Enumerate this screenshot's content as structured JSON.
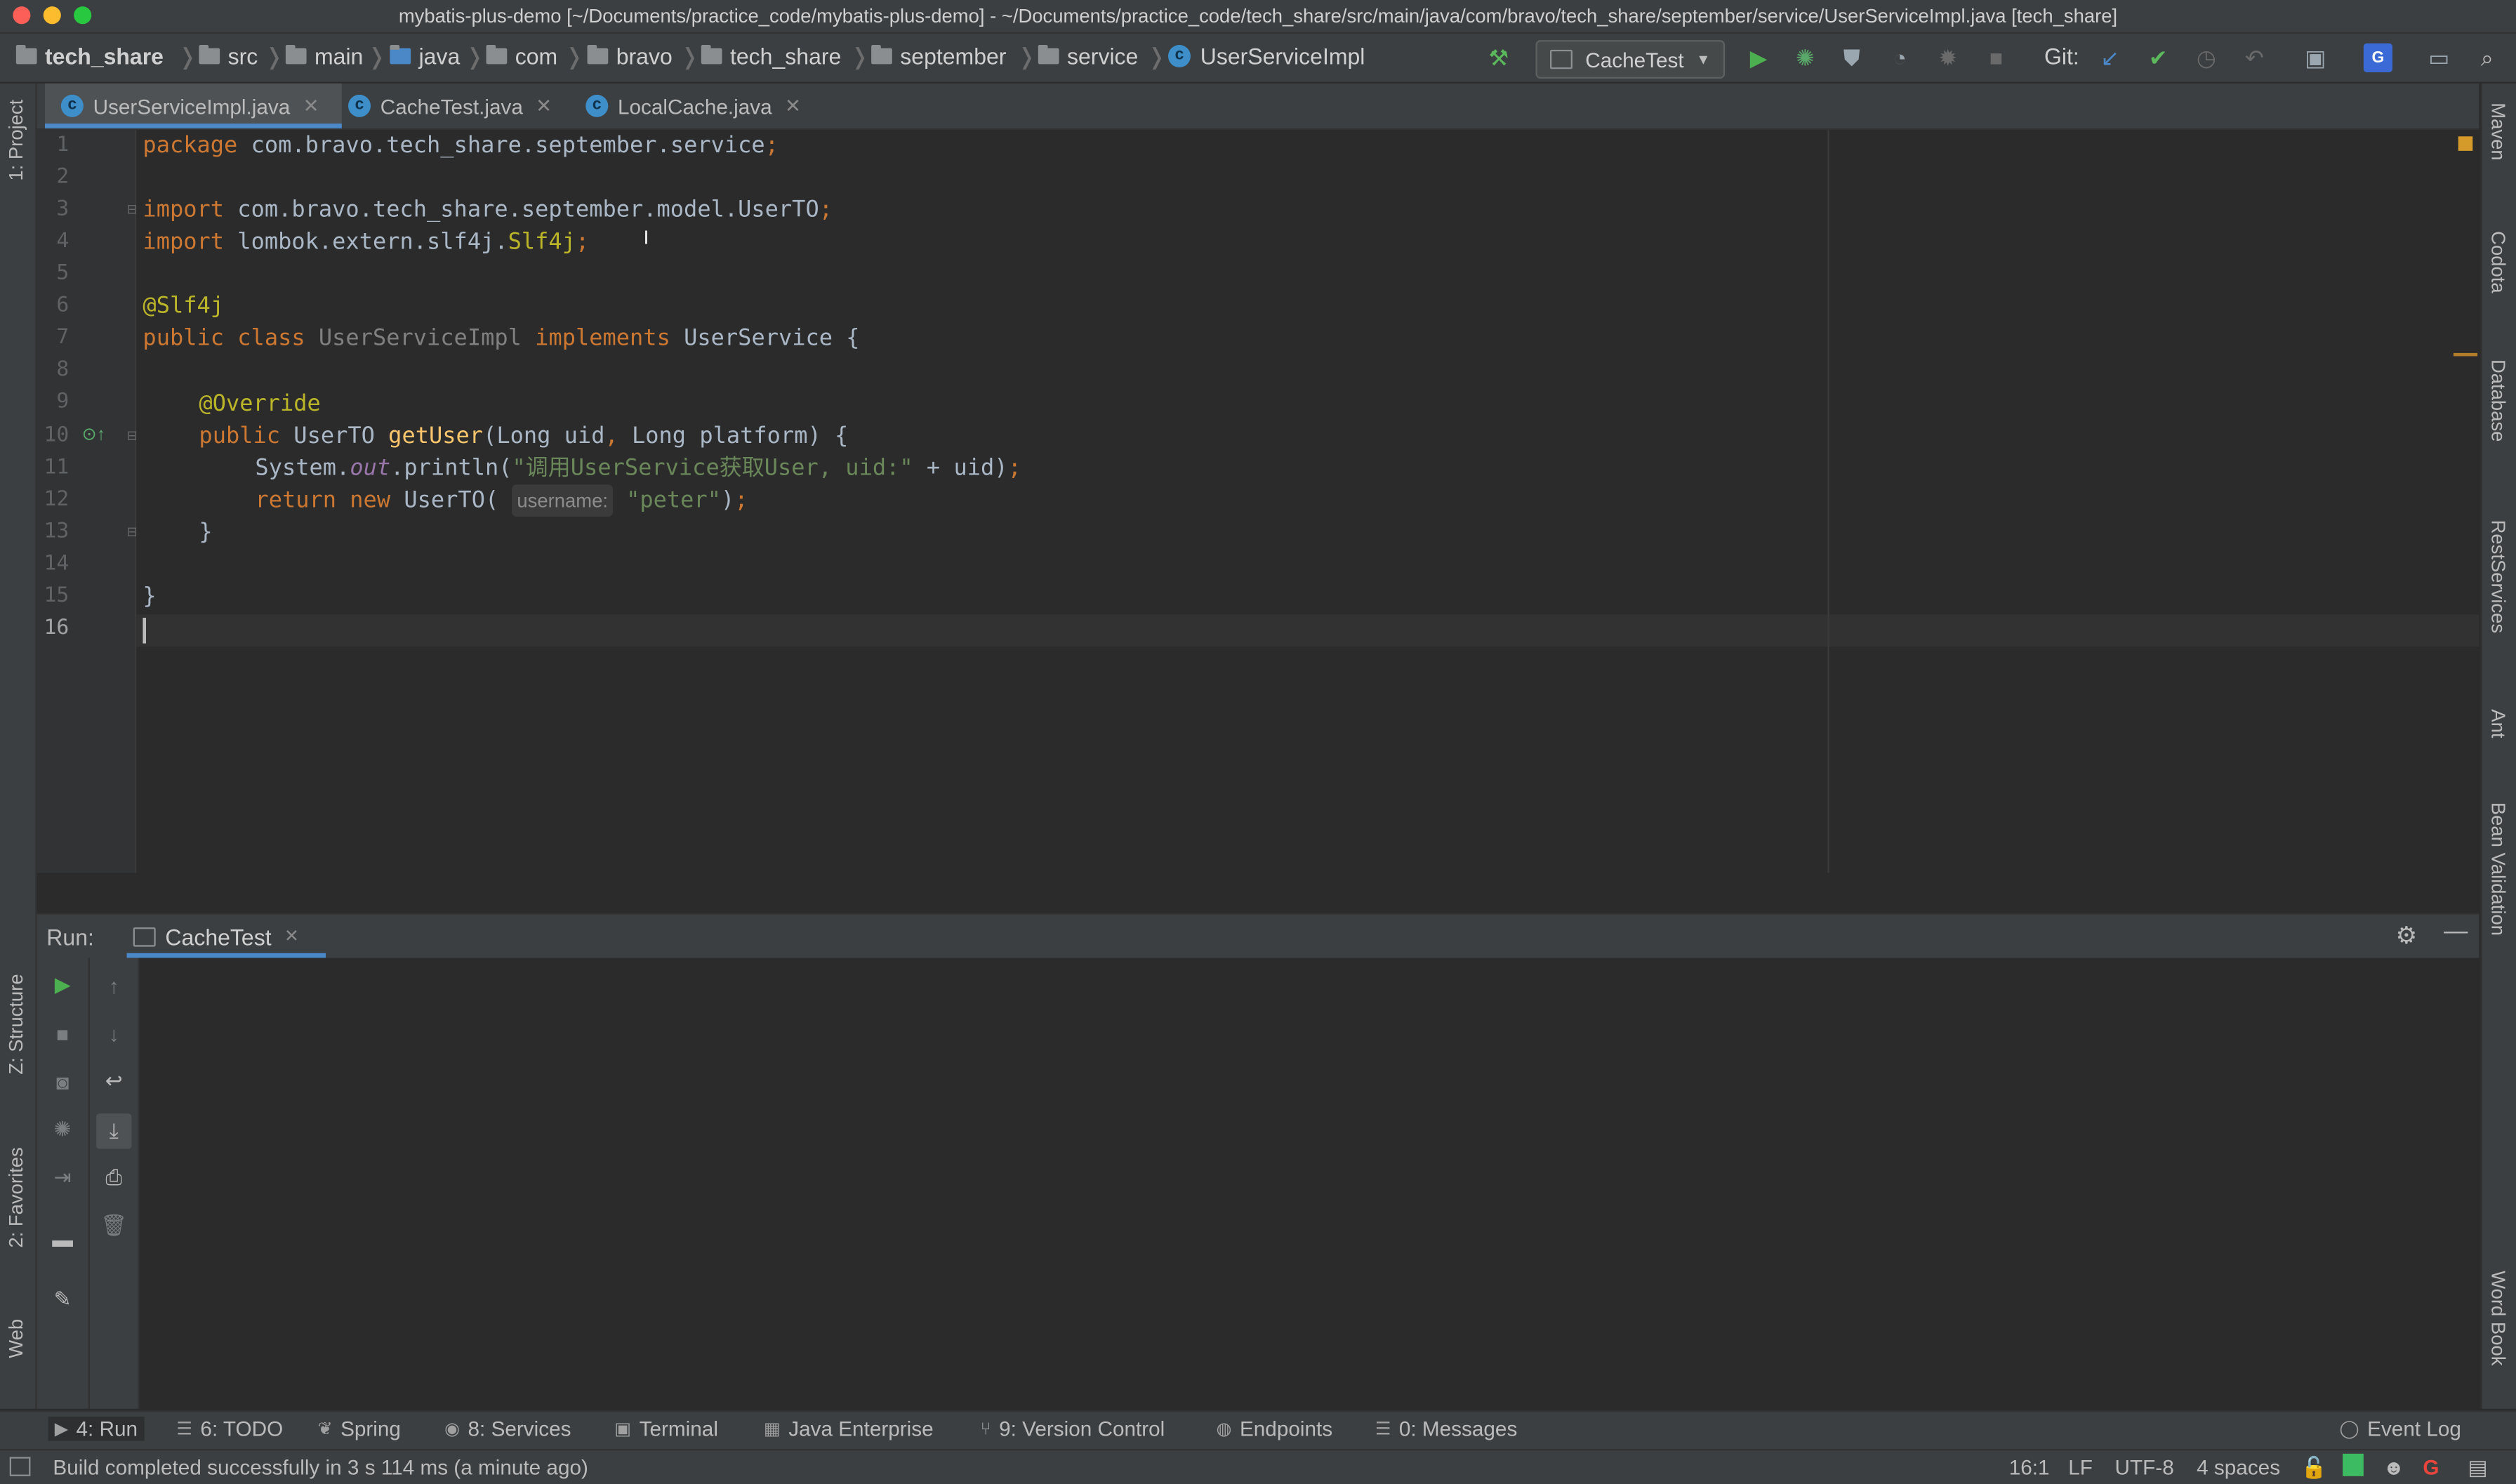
{
  "window": {
    "title": "mybatis-plus-demo [~/Documents/practice_code/mybatis-plus-demo] - ~/Documents/practice_code/tech_share/src/main/java/com/bravo/tech_share/september/service/UserServiceImpl.java [tech_share]"
  },
  "breadcrumb": [
    "tech_share",
    "src",
    "main",
    "java",
    "com",
    "bravo",
    "tech_share",
    "september",
    "service",
    "UserServiceImpl"
  ],
  "toolbar": {
    "run_config": "CacheTest",
    "git_label": "Git:"
  },
  "tabs": [
    {
      "label": "UserServiceImpl.java",
      "active": true
    },
    {
      "label": "CacheTest.java",
      "active": false
    },
    {
      "label": "LocalCache.java",
      "active": false
    }
  ],
  "editor": {
    "line_numbers": [
      "1",
      "2",
      "3",
      "4",
      "5",
      "6",
      "7",
      "8",
      "9",
      "10",
      "11",
      "12",
      "13",
      "14",
      "15",
      "16"
    ],
    "code": {
      "l1_kw": "package",
      "l1_rest": " com.bravo.tech_share.september.service",
      "semi": ";",
      "l3_kw": "import",
      "l3_rest": " com.bravo.tech_share.september.model.UserTO",
      "l4_kw": "import",
      "l4_rest": " lombok.extern.slf4j.",
      "l4_cls": "Slf4j",
      "l6_ann": "@Slf4j",
      "l7_kw1": "public class",
      "l7_name": " UserServiceImpl ",
      "l7_kw2": "implements",
      "l7_rest": " UserService {",
      "l9_ann": "@Override",
      "l10_kw": "public",
      "l10_type": " UserTO ",
      "l10_fn": "getUser",
      "l10_p1": "(Long uid",
      "l10_comma": ",",
      "l10_p2": " Long platform) {",
      "l11_a": "System.",
      "l11_out": "out",
      "l11_b": ".println(",
      "l11_str": "\"调用UserService获取User, uid:\"",
      "l11_c": " + uid)",
      "l12_kw": "return new",
      "l12_a": " UserTO( ",
      "l12_hint": "username:",
      "l12_str": "\"peter\"",
      "l12_b": ")",
      "l13": "}",
      "l15": "}"
    }
  },
  "left_tool_tabs": {
    "project": "1: Project",
    "structure": "Z: Structure",
    "favorites": "2: Favorites",
    "web": "Web"
  },
  "right_tool_tabs": {
    "maven": "Maven",
    "codota": "Codota",
    "database": "Database",
    "rest": "RestServices",
    "ant": "Ant",
    "bean": "Bean Validation",
    "wordbook": "Word Book"
  },
  "run_panel": {
    "label": "Run:",
    "tab": "CacheTest"
  },
  "bottom_tabs": [
    "4: Run",
    "6: TODO",
    "Spring",
    "8: Services",
    "Terminal",
    "Java Enterprise",
    "9: Version Control",
    "Endpoints",
    "0: Messages"
  ],
  "event_log": "Event Log",
  "status": {
    "message": "Build completed successfully in 3 s 114 ms (a minute ago)",
    "position": "16:1",
    "line_sep": "LF",
    "encoding": "UTF-8",
    "indent": "4 spaces"
  },
  "colors": {
    "accent": "#4a88c7",
    "run_green": "#4caf50"
  }
}
